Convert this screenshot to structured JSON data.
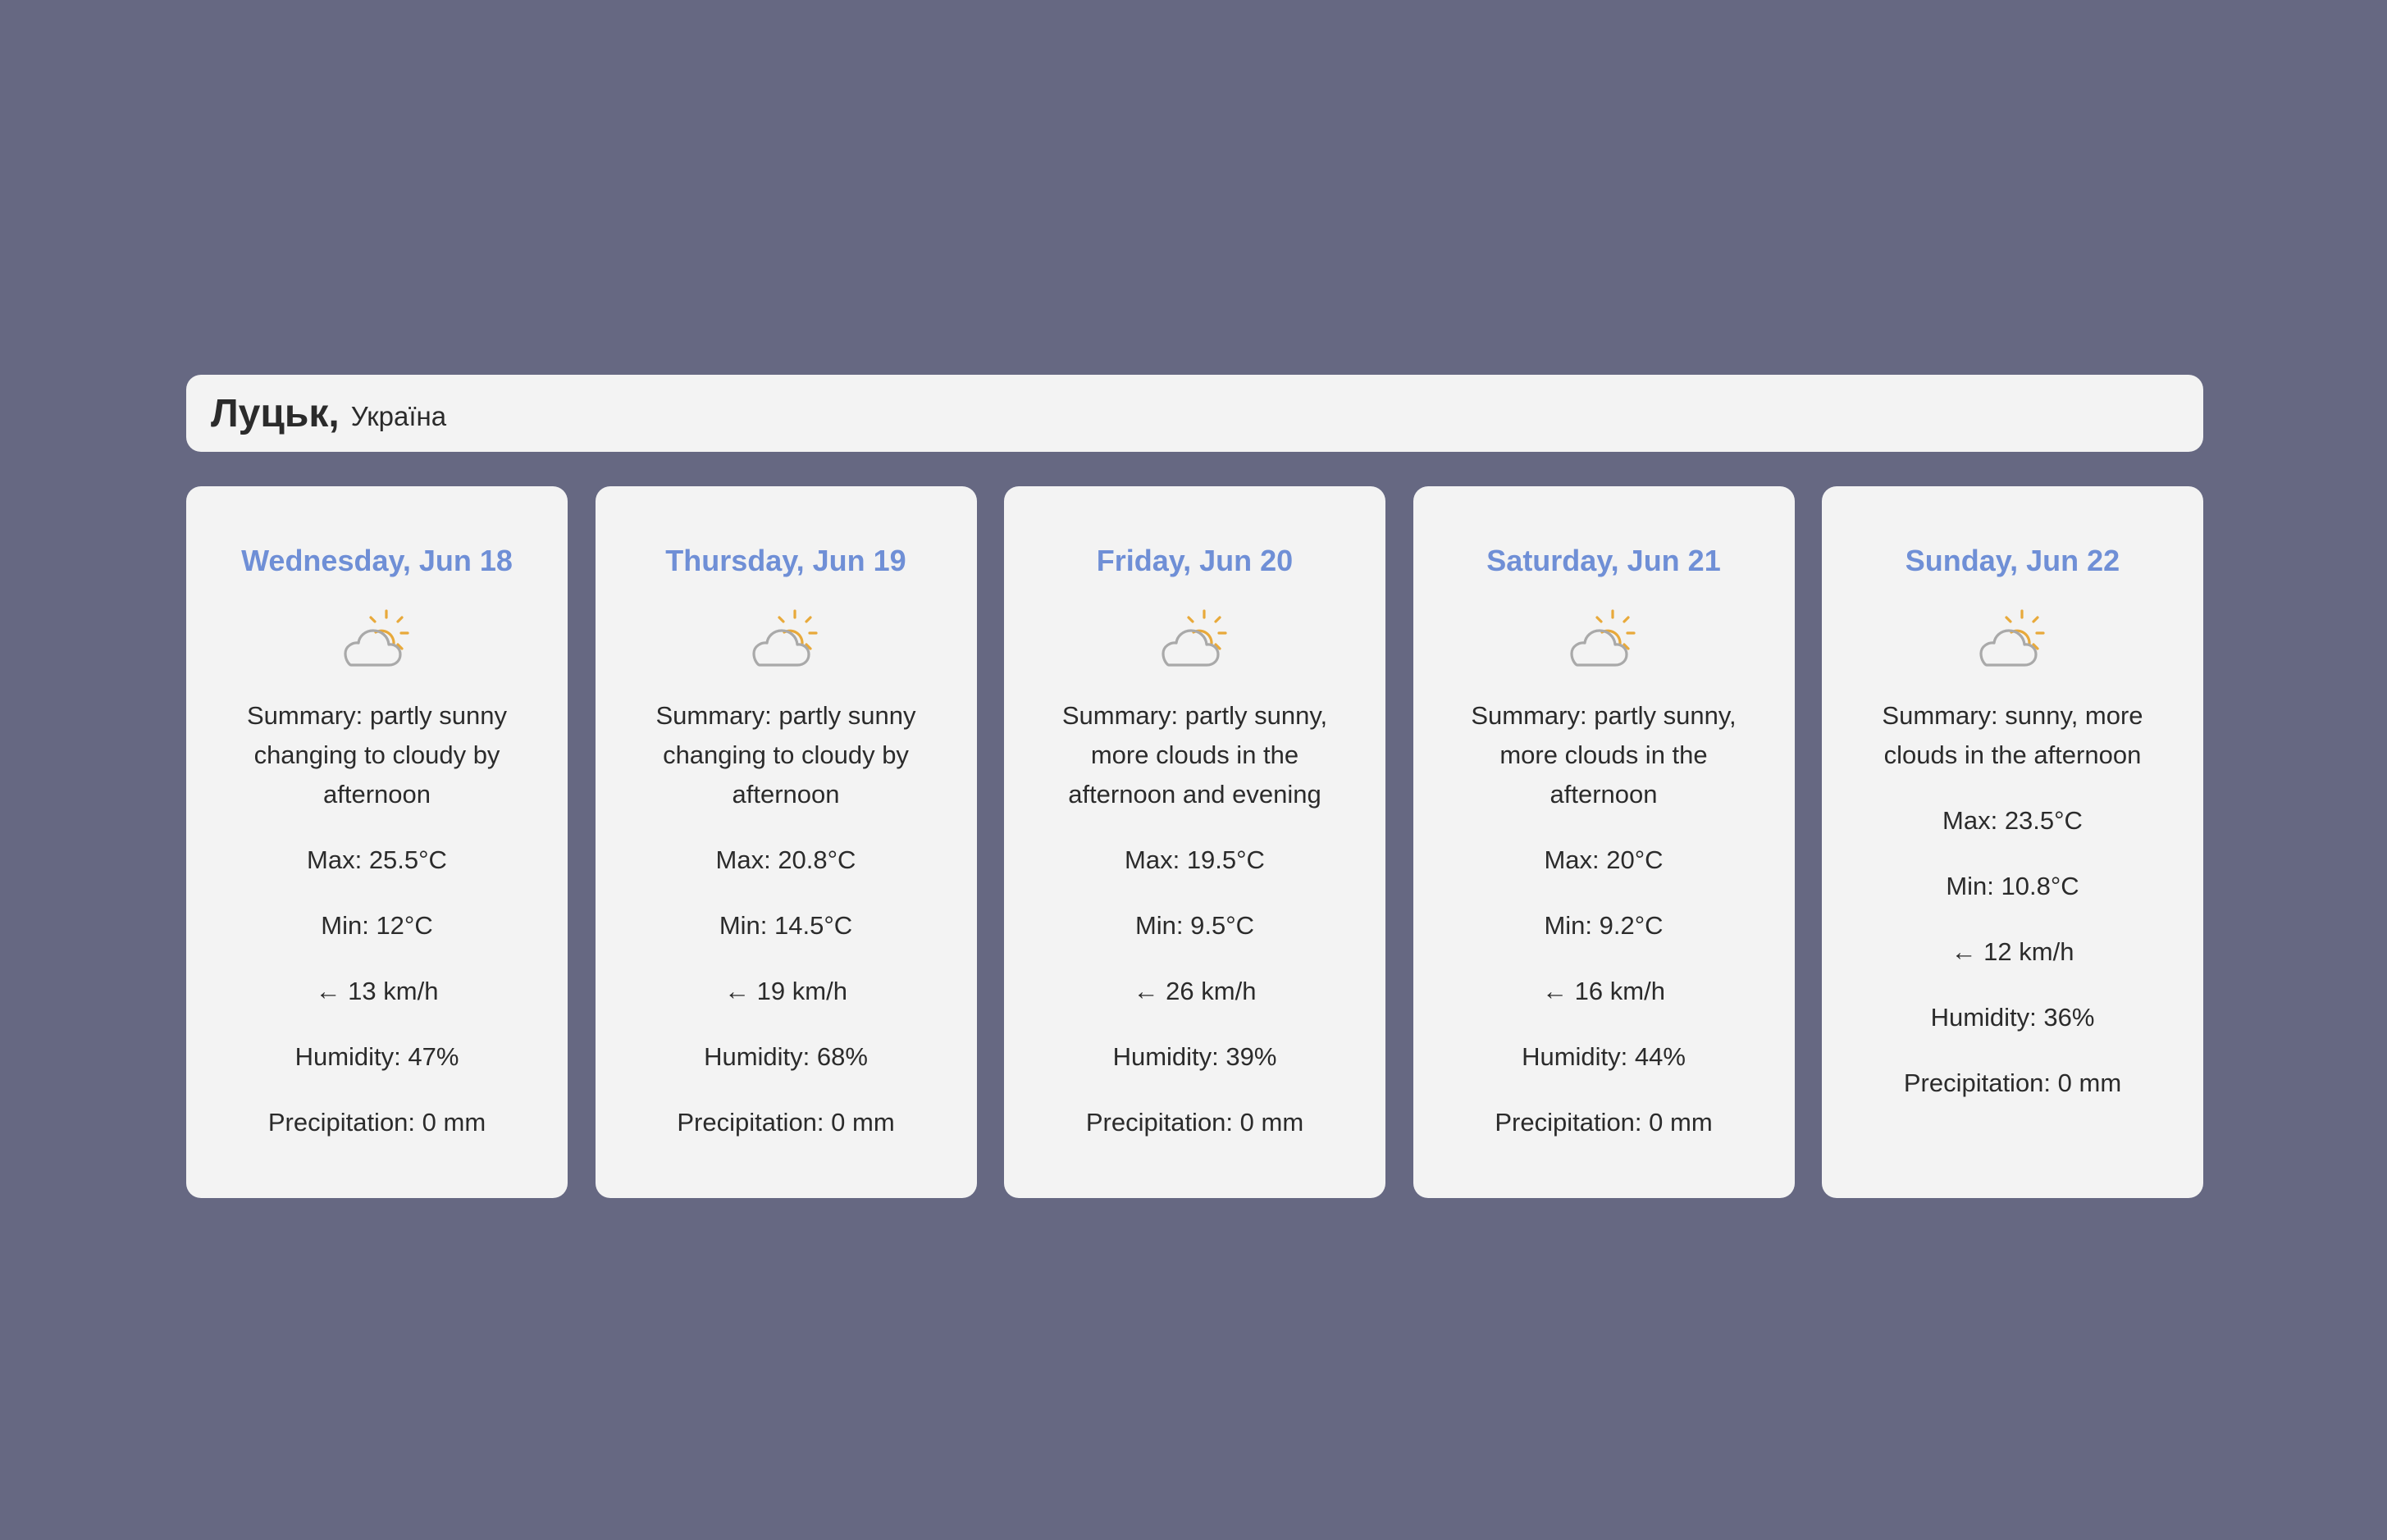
{
  "location": {
    "city": "Луцьк",
    "country": "Україна"
  },
  "colors": {
    "background": "#666882",
    "card": "#f3f3f3",
    "day_title": "#6f8fd6",
    "sun": "#e8a93a",
    "cloud": "#a9a9a9"
  },
  "days": [
    {
      "title": "Wednesday, Jun 18",
      "icon": "partly-cloudy-icon",
      "summary": "Summary: partly sunny changing to cloudy by afternoon",
      "max": "Max: 25.5°C",
      "min": "Min: 12°C",
      "wind": "← 13 km/h",
      "humidity": "Humidity: 47%",
      "precipitation": "Precipitation: 0 mm"
    },
    {
      "title": "Thursday, Jun 19",
      "icon": "partly-cloudy-icon",
      "summary": "Summary: partly sunny changing to cloudy by afternoon",
      "max": "Max: 20.8°C",
      "min": "Min: 14.5°C",
      "wind": "← 19 km/h",
      "humidity": "Humidity: 68%",
      "precipitation": "Precipitation: 0 mm"
    },
    {
      "title": "Friday, Jun 20",
      "icon": "partly-cloudy-icon",
      "summary": "Summary: partly sunny, more clouds in the afternoon and evening",
      "max": "Max: 19.5°C",
      "min": "Min: 9.5°C",
      "wind": "← 26 km/h",
      "humidity": "Humidity: 39%",
      "precipitation": "Precipitation: 0 mm"
    },
    {
      "title": "Saturday, Jun 21",
      "icon": "partly-cloudy-icon",
      "summary": "Summary: partly sunny, more clouds in the afternoon",
      "max": "Max: 20°C",
      "min": "Min: 9.2°C",
      "wind": "← 16 km/h",
      "humidity": "Humidity: 44%",
      "precipitation": "Precipitation: 0 mm"
    },
    {
      "title": "Sunday, Jun 22",
      "icon": "partly-cloudy-icon",
      "summary": "Summary: sunny, more clouds in the afternoon",
      "max": "Max: 23.5°C",
      "min": "Min: 10.8°C",
      "wind": "← 12 km/h",
      "humidity": "Humidity: 36%",
      "precipitation": "Precipitation: 0 mm"
    }
  ]
}
